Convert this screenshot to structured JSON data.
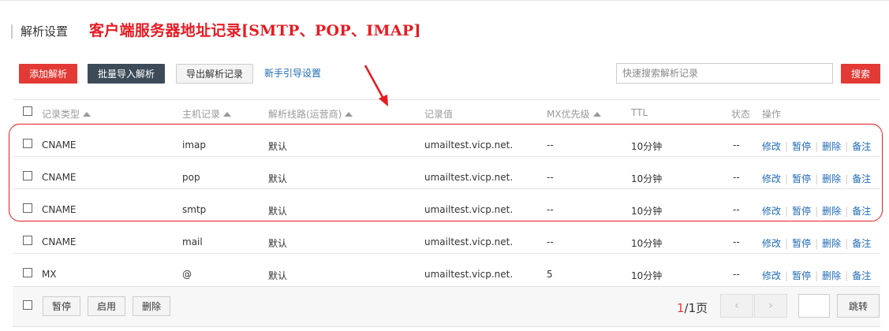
{
  "header": {
    "title": "解析设置",
    "annotation": "客户端服务器地址记录[SMTP、POP、IMAP]"
  },
  "toolbar": {
    "add": "添加解析",
    "import": "批量导入解析",
    "export": "导出解析记录",
    "guide": "新手引导设置",
    "search_placeholder": "快速搜索解析记录",
    "search": "搜索"
  },
  "columns": {
    "type": "记录类型",
    "host": "主机记录",
    "line": "解析线路(运营商)",
    "value": "记录值",
    "mx": "MX优先级",
    "ttl": "TTL",
    "status": "状态",
    "ops": "操作"
  },
  "rows": [
    {
      "type": "CNAME",
      "host": "imap",
      "line": "默认",
      "value": "umailtest.vicp.net.",
      "mx": "--",
      "ttl": "10分钟",
      "status": "--"
    },
    {
      "type": "CNAME",
      "host": "pop",
      "line": "默认",
      "value": "umailtest.vicp.net.",
      "mx": "--",
      "ttl": "10分钟",
      "status": "--"
    },
    {
      "type": "CNAME",
      "host": "smtp",
      "line": "默认",
      "value": "umailtest.vicp.net.",
      "mx": "--",
      "ttl": "10分钟",
      "status": "--"
    },
    {
      "type": "CNAME",
      "host": "mail",
      "line": "默认",
      "value": "umailtest.vicp.net.",
      "mx": "--",
      "ttl": "10分钟",
      "status": "--"
    },
    {
      "type": "MX",
      "host": "@",
      "line": "默认",
      "value": "umailtest.vicp.net.",
      "mx": "5",
      "ttl": "10分钟",
      "status": "--"
    }
  ],
  "row_actions": {
    "edit": "修改",
    "pause": "暂停",
    "delete": "删除",
    "note": "备注",
    "sep": "|"
  },
  "footer": {
    "pause": "暂停",
    "enable": "启用",
    "delete": "删除",
    "page_current": "1",
    "page_total": "/1页",
    "prev": "‹",
    "next": "›",
    "jump": "跳转"
  },
  "colors": {
    "accent_red": "#e33a35",
    "dark_button": "#3d4b58",
    "link_blue": "#1e6ab5",
    "annotation_red": "#e51c23"
  },
  "icons": {
    "sort": "sort-up-triangle-icon",
    "prev": "chevron-left-icon",
    "next": "chevron-right-icon"
  }
}
